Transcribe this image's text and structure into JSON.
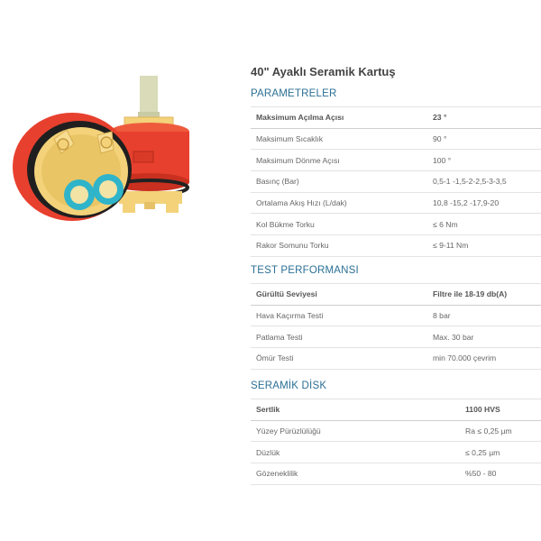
{
  "title": "40\" Ayaklı Seramik Kartuş",
  "sections": [
    {
      "heading": "PARAMETRELER",
      "rows": [
        [
          "Maksimum Açılma Açısı",
          "23 °"
        ],
        [
          "Maksimum Sıcaklık",
          "90 °"
        ],
        [
          "Maksimum Dönme Açısı",
          "100 °"
        ],
        [
          "Basınç (Bar)",
          "0,5-1 -1,5-2-2,5-3-3,5"
        ],
        [
          "Ortalama Akış Hızı (L/dak)",
          "10,8 -15,2 -17,9-20"
        ],
        [
          "Kol Bükme Torku",
          "≤ 6 Nm"
        ],
        [
          "Rakor Somunu Torku",
          "≤ 9-11 Nm"
        ]
      ]
    },
    {
      "heading": "TEST PERFORMANSI",
      "rows": [
        [
          "Gürültü Seviyesi",
          "Filtre ile 18-19 db(A)"
        ],
        [
          "Hava Kaçırma Testi",
          "8 bar"
        ],
        [
          "Patlama Testi",
          "Max. 30 bar"
        ],
        [
          "Ömür Testi",
          "min 70.000 çevrim"
        ]
      ]
    },
    {
      "heading": "SERAMİK DİSK",
      "rows": [
        [
          "Sertlik",
          "1100 HVS"
        ],
        [
          "Yüzey Pürüzlülüğü",
          "Ra ≤ 0,25 µm"
        ],
        [
          "Düzlük",
          "≤ 0,25 µm"
        ],
        [
          "Gözeneklilik",
          "%50 - 80"
        ]
      ]
    }
  ],
  "colors": {
    "heading": "#2b6f94",
    "cartridge_red": "#e8402e",
    "cartridge_yellow": "#f3d27a",
    "port_teal": "#2fb4c9"
  }
}
